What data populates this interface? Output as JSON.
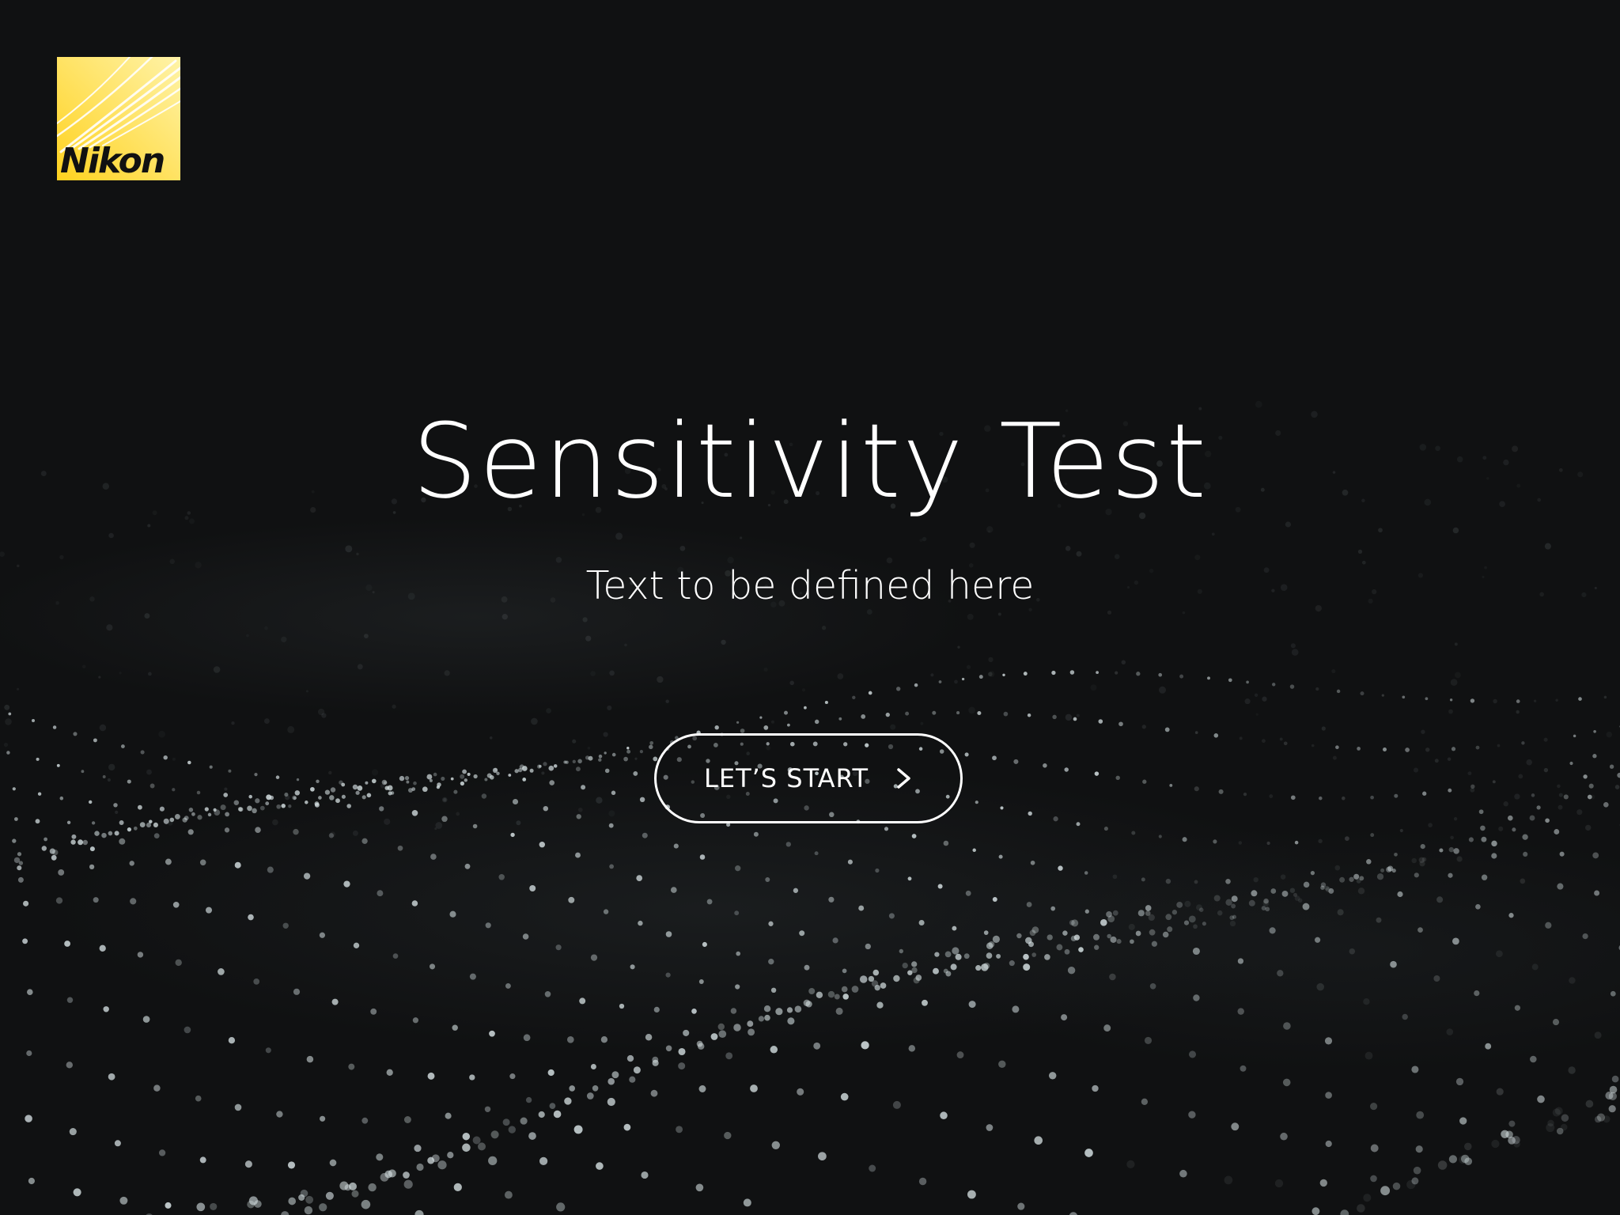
{
  "logo": {
    "wordmark": "Nikon",
    "color": "#ffe04a"
  },
  "hero": {
    "title": "Sensitivity Test",
    "subtitle": "Text to be defined here"
  },
  "cta": {
    "label": "LET’S START",
    "icon": "chevron-right-icon"
  },
  "colors": {
    "background": "#101112",
    "text": "#ffffff",
    "brand": "#ffe04a"
  }
}
